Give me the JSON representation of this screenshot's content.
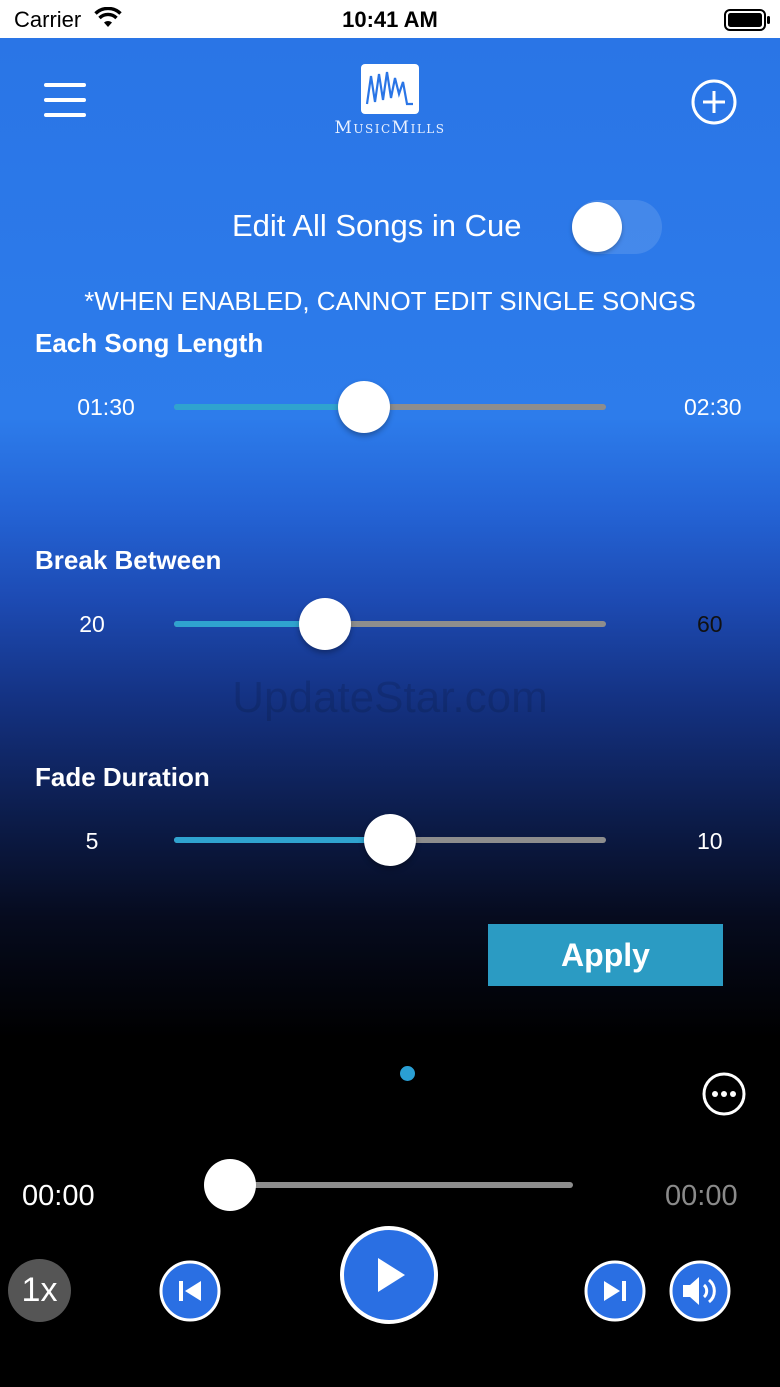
{
  "status_bar": {
    "carrier": "Carrier",
    "time": "10:41 AM"
  },
  "header": {
    "logo_text": "MusicMills",
    "icons": [
      "menu-icon",
      "music-mills-logo",
      "add-circle-icon"
    ]
  },
  "edit_all": {
    "label": "Edit All Songs in Cue",
    "enabled": false
  },
  "warning": "*WHEN ENABLED, CANNOT EDIT SINGLE SONGS",
  "sliders": {
    "song_length": {
      "title": "Each Song Length",
      "min_label": "01:30",
      "max_label": "02:30",
      "value_fraction": 0.44
    },
    "break_between": {
      "title": "Break Between",
      "min_label": "20",
      "max_label": "60",
      "value_fraction": 0.35
    },
    "fade_duration": {
      "title": "Fade Duration",
      "min_label": "5",
      "max_label": "10",
      "value_fraction": 0.5
    }
  },
  "watermark": "UpdateStar.com",
  "apply_label": "Apply",
  "player": {
    "current_time": "00:00",
    "total_time": "00:00",
    "progress_fraction": 0,
    "speed_label": "1x",
    "icons": [
      "more-icon",
      "previous-icon",
      "play-icon",
      "next-icon",
      "volume-icon"
    ]
  },
  "colors": {
    "accent": "#2b9bc3",
    "track_fill": "#2fa3cf",
    "track": "#8d8d8d",
    "bg_top": "#2a75e6",
    "bg_bottom": "#000000"
  }
}
